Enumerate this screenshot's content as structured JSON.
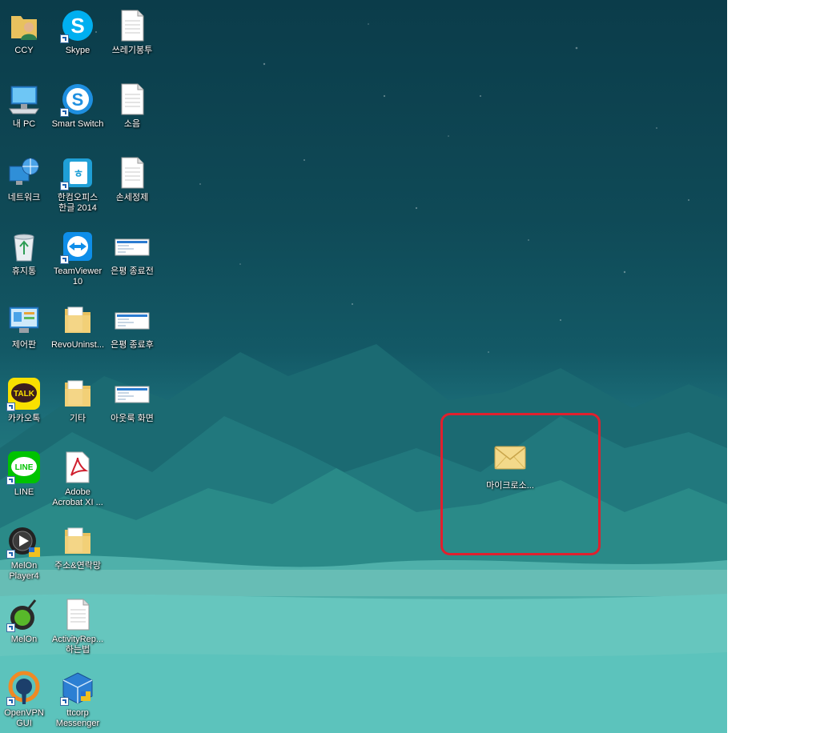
{
  "desktop": {
    "icons": [
      {
        "label": "CCY",
        "icon": "user-folder-icon"
      },
      {
        "label": "Skype",
        "icon": "skype-icon"
      },
      {
        "label": "쓰레기봉투",
        "icon": "text-document-icon"
      },
      {
        "label": "내 PC",
        "icon": "this-pc-icon"
      },
      {
        "label": "Smart Switch",
        "icon": "smart-switch-icon"
      },
      {
        "label": "소음",
        "icon": "text-document-icon"
      },
      {
        "label": "네트워크",
        "icon": "network-icon"
      },
      {
        "label": "한컴오피스\n한글 2014",
        "icon": "hancom-office-icon"
      },
      {
        "label": "손세정제",
        "icon": "text-document-icon"
      },
      {
        "label": "휴지통",
        "icon": "recycle-bin-icon"
      },
      {
        "label": "TeamViewer\n10",
        "icon": "teamviewer-icon"
      },
      {
        "label": "은평 종료전",
        "icon": "screenshot-image-icon"
      },
      {
        "label": "제어판",
        "icon": "control-panel-icon"
      },
      {
        "label": "RevoUninst...",
        "icon": "folder-icon"
      },
      {
        "label": "은평 종료후",
        "icon": "screenshot-image-icon"
      },
      {
        "label": "카카오톡",
        "icon": "kakaotalk-icon"
      },
      {
        "label": "기타",
        "icon": "folder-icon"
      },
      {
        "label": "아웃룩 화면",
        "icon": "screenshot-image-icon"
      },
      {
        "label": "LINE",
        "icon": "line-icon"
      },
      {
        "label": "Adobe\nAcrobat XI ...",
        "icon": "adobe-acrobat-icon"
      },
      {
        "label": "MelOn\nPlayer4",
        "icon": "melon-player-icon"
      },
      {
        "label": "주소&연락망",
        "icon": "folder-icon"
      },
      {
        "label": "MelOn",
        "icon": "melon-icon"
      },
      {
        "label": "ActivityRep...\n하는법",
        "icon": "text-document-icon"
      },
      {
        "label": "OpenVPN\nGUI",
        "icon": "openvpn-icon"
      },
      {
        "label": "ttcorp\nMessenger",
        "icon": "messenger-icon"
      }
    ],
    "highlighted_icon": {
      "label": "마이크로소...",
      "icon": "mail-envelope-icon"
    },
    "highlight_color": "#e0202e"
  }
}
